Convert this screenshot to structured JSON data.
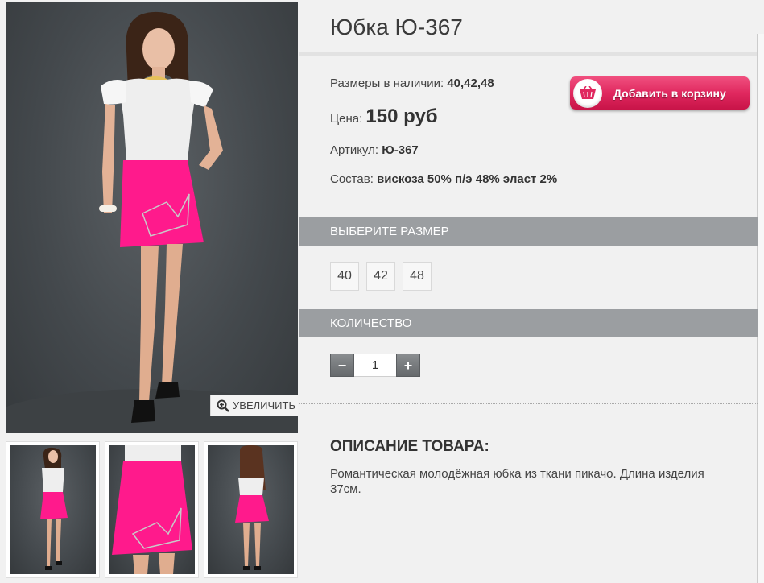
{
  "product": {
    "title": "Юбка Ю-367"
  },
  "gallery": {
    "zoom_label": "УВЕЛИЧИТЬ"
  },
  "info": {
    "sizes_label": "Размеры в наличии:",
    "sizes_value": "40,42,48",
    "price_label": "Цена:",
    "price_value": "150 руб",
    "article_label": "Артикул:",
    "article_value": "Ю-367",
    "composition_label": "Состав:",
    "composition_value": "вискоза 50% п/э 48% эласт 2%"
  },
  "cart": {
    "label": "Добавить в корзину"
  },
  "size_section": {
    "title": "ВЫБЕРИТЕ РАЗМЕР",
    "options": [
      "40",
      "42",
      "48"
    ]
  },
  "quantity_section": {
    "title": "КОЛИЧЕСТВО",
    "minus": "−",
    "plus": "+",
    "value": "1"
  },
  "description": {
    "title": "ОПИСАНИЕ ТОВАРА:",
    "text": "Романтическая молодёжная юбка из ткани пикачо. Длина изделия 37см."
  },
  "colors": {
    "skirt": "#ff1a8c",
    "section_bar": "#9b9ea1",
    "cart_button": "#e0285f"
  }
}
